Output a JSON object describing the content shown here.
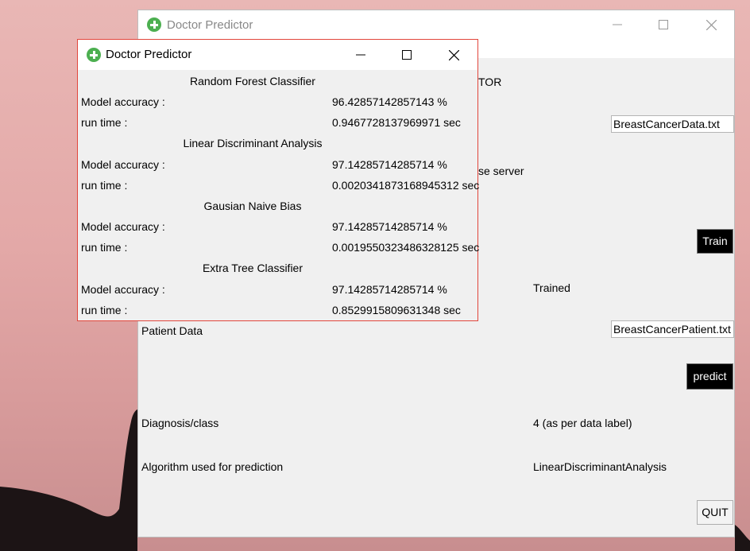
{
  "back_window": {
    "title": "Doctor Predictor",
    "heading_partial": "TOR",
    "dataset_entry": "BreastCancerData.txt",
    "server_label_partial": "se server",
    "train_button": "Train",
    "train_status": "Trained",
    "patient_data_label": "Patient Data",
    "patient_entry": "BreastCancerPatient.txt",
    "predict_button": "predict",
    "diagnosis_label": "Diagnosis/class",
    "diagnosis_value": "4 (as per data label)",
    "algorithm_label": "Algorithm used for prediction",
    "algorithm_value": "LinearDiscriminantAnalysis",
    "quit_button": "QUIT"
  },
  "front_window": {
    "title": "Doctor Predictor",
    "models": [
      {
        "name": "Random Forest Classifier",
        "accuracy_label": "Model accuracy :",
        "accuracy": "96.42857142857143 %",
        "runtime_label": "run time :",
        "runtime": "0.9467728137969971 sec"
      },
      {
        "name": "Linear Discriminant Analysis",
        "accuracy_label": "Model accuracy :",
        "accuracy": "97.14285714285714 %",
        "runtime_label": "run time :",
        "runtime": "0.0020341873168945312 sec"
      },
      {
        "name": "Gausian Naive Bias",
        "accuracy_label": "Model accuracy :",
        "accuracy": "97.14285714285714 %",
        "runtime_label": "run time :",
        "runtime": "0.0019550323486328125 sec"
      },
      {
        "name": "Extra Tree Classifier",
        "accuracy_label": "Model accuracy :",
        "accuracy": "97.14285714285714 %",
        "runtime_label": "run time :",
        "runtime": "0.8529915809631348 sec"
      }
    ]
  },
  "colors": {
    "icon_green": "#4caf50",
    "front_border": "#e2463c",
    "window_bg": "#f0f0f0"
  }
}
